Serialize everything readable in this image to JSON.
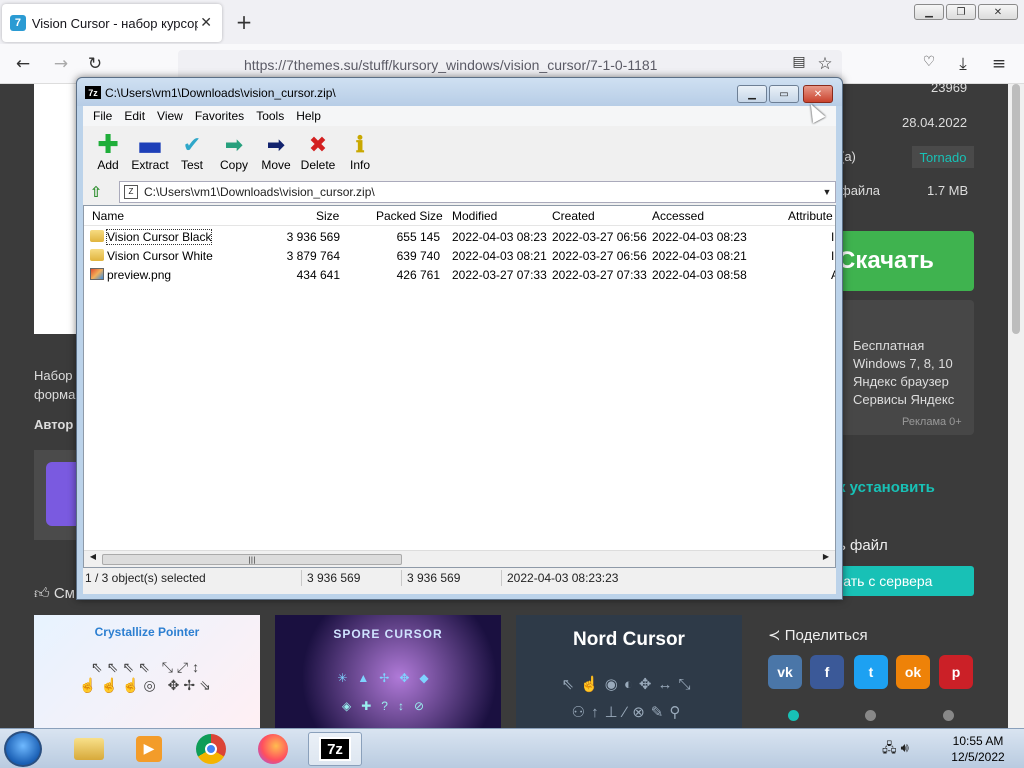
{
  "browser": {
    "tab_title": "Vision Cursor - набор курсоров",
    "tab_favicon": "7",
    "url": "https://7themes.su/stuff/kursory_windows/vision_cursor/7-1-0-1181"
  },
  "page": {
    "downloads": "23969",
    "date": "28.04.2022",
    "author_label_suffix": "(а)",
    "author": "Tornado",
    "file_label_suffix": "файла",
    "file_size": "1.7 MB",
    "download_button": "Скачать",
    "info_lines": [
      "Бесплатная",
      "Windows 7, 8, 10",
      "Яндекс браузер",
      "Сервисы Яндекс"
    ],
    "ad_label": "Реклама 0+",
    "install_link": "к установить",
    "file_heading": "ь файл",
    "server_button": "чать с сервера",
    "desc_1": "Набор",
    "desc_2": "форма",
    "author_heading": "Автор",
    "related_heading": "См",
    "share_heading": "Поделиться",
    "thumbs": [
      "Crystallize Pointer",
      "SPORE CURSOR",
      "Nord Cursor"
    ],
    "social": [
      "vk",
      "f",
      "t",
      "ok",
      "p"
    ]
  },
  "sevenzip": {
    "title": "C:\\Users\\vm1\\Downloads\\vision_cursor.zip\\",
    "app_icon": "7z",
    "menu": [
      "File",
      "Edit",
      "View",
      "Favorites",
      "Tools",
      "Help"
    ],
    "toolbar": [
      {
        "label": "Add",
        "icon": "plus-icon",
        "color": "#1fae3a"
      },
      {
        "label": "Extract",
        "icon": "minus-icon",
        "color": "#1d3fb8"
      },
      {
        "label": "Test",
        "icon": "check-icon",
        "color": "#2fa7c9"
      },
      {
        "label": "Copy",
        "icon": "copy-arrow-icon",
        "color": "#27a07d"
      },
      {
        "label": "Move",
        "icon": "move-arrow-icon",
        "color": "#12236e"
      },
      {
        "label": "Delete",
        "icon": "delete-x-icon",
        "color": "#d32020"
      },
      {
        "label": "Info",
        "icon": "info-icon",
        "color": "#c9a800"
      }
    ],
    "address": "C:\\Users\\vm1\\Downloads\\vision_cursor.zip\\",
    "columns": [
      "Name",
      "Size",
      "Packed Size",
      "Modified",
      "Created",
      "Accessed",
      "Attribute"
    ],
    "rows": [
      {
        "name": "Vision Cursor Black",
        "size": "3 936 569",
        "packed": "655 145",
        "modified": "2022-04-03 08:23",
        "created": "2022-03-27 06:56",
        "accessed": "2022-04-03 08:23",
        "attr": "I",
        "type": "folder"
      },
      {
        "name": "Vision Cursor White",
        "size": "3 879 764",
        "packed": "639 740",
        "modified": "2022-04-03 08:21",
        "created": "2022-03-27 06:56",
        "accessed": "2022-04-03 08:21",
        "attr": "I",
        "type": "folder"
      },
      {
        "name": "preview.png",
        "size": "434 641",
        "packed": "426 761",
        "modified": "2022-03-27 07:33",
        "created": "2022-03-27 07:33",
        "accessed": "2022-04-03 08:58",
        "attr": "A",
        "type": "png"
      }
    ],
    "status": {
      "selected": "1 / 3 object(s) selected",
      "size": "3 936 569",
      "packed": "3 936 569",
      "modified": "2022-04-03 08:23:23"
    }
  },
  "taskbar": {
    "time": "10:55 AM",
    "date": "12/5/2022",
    "active_app_label": "7z"
  }
}
